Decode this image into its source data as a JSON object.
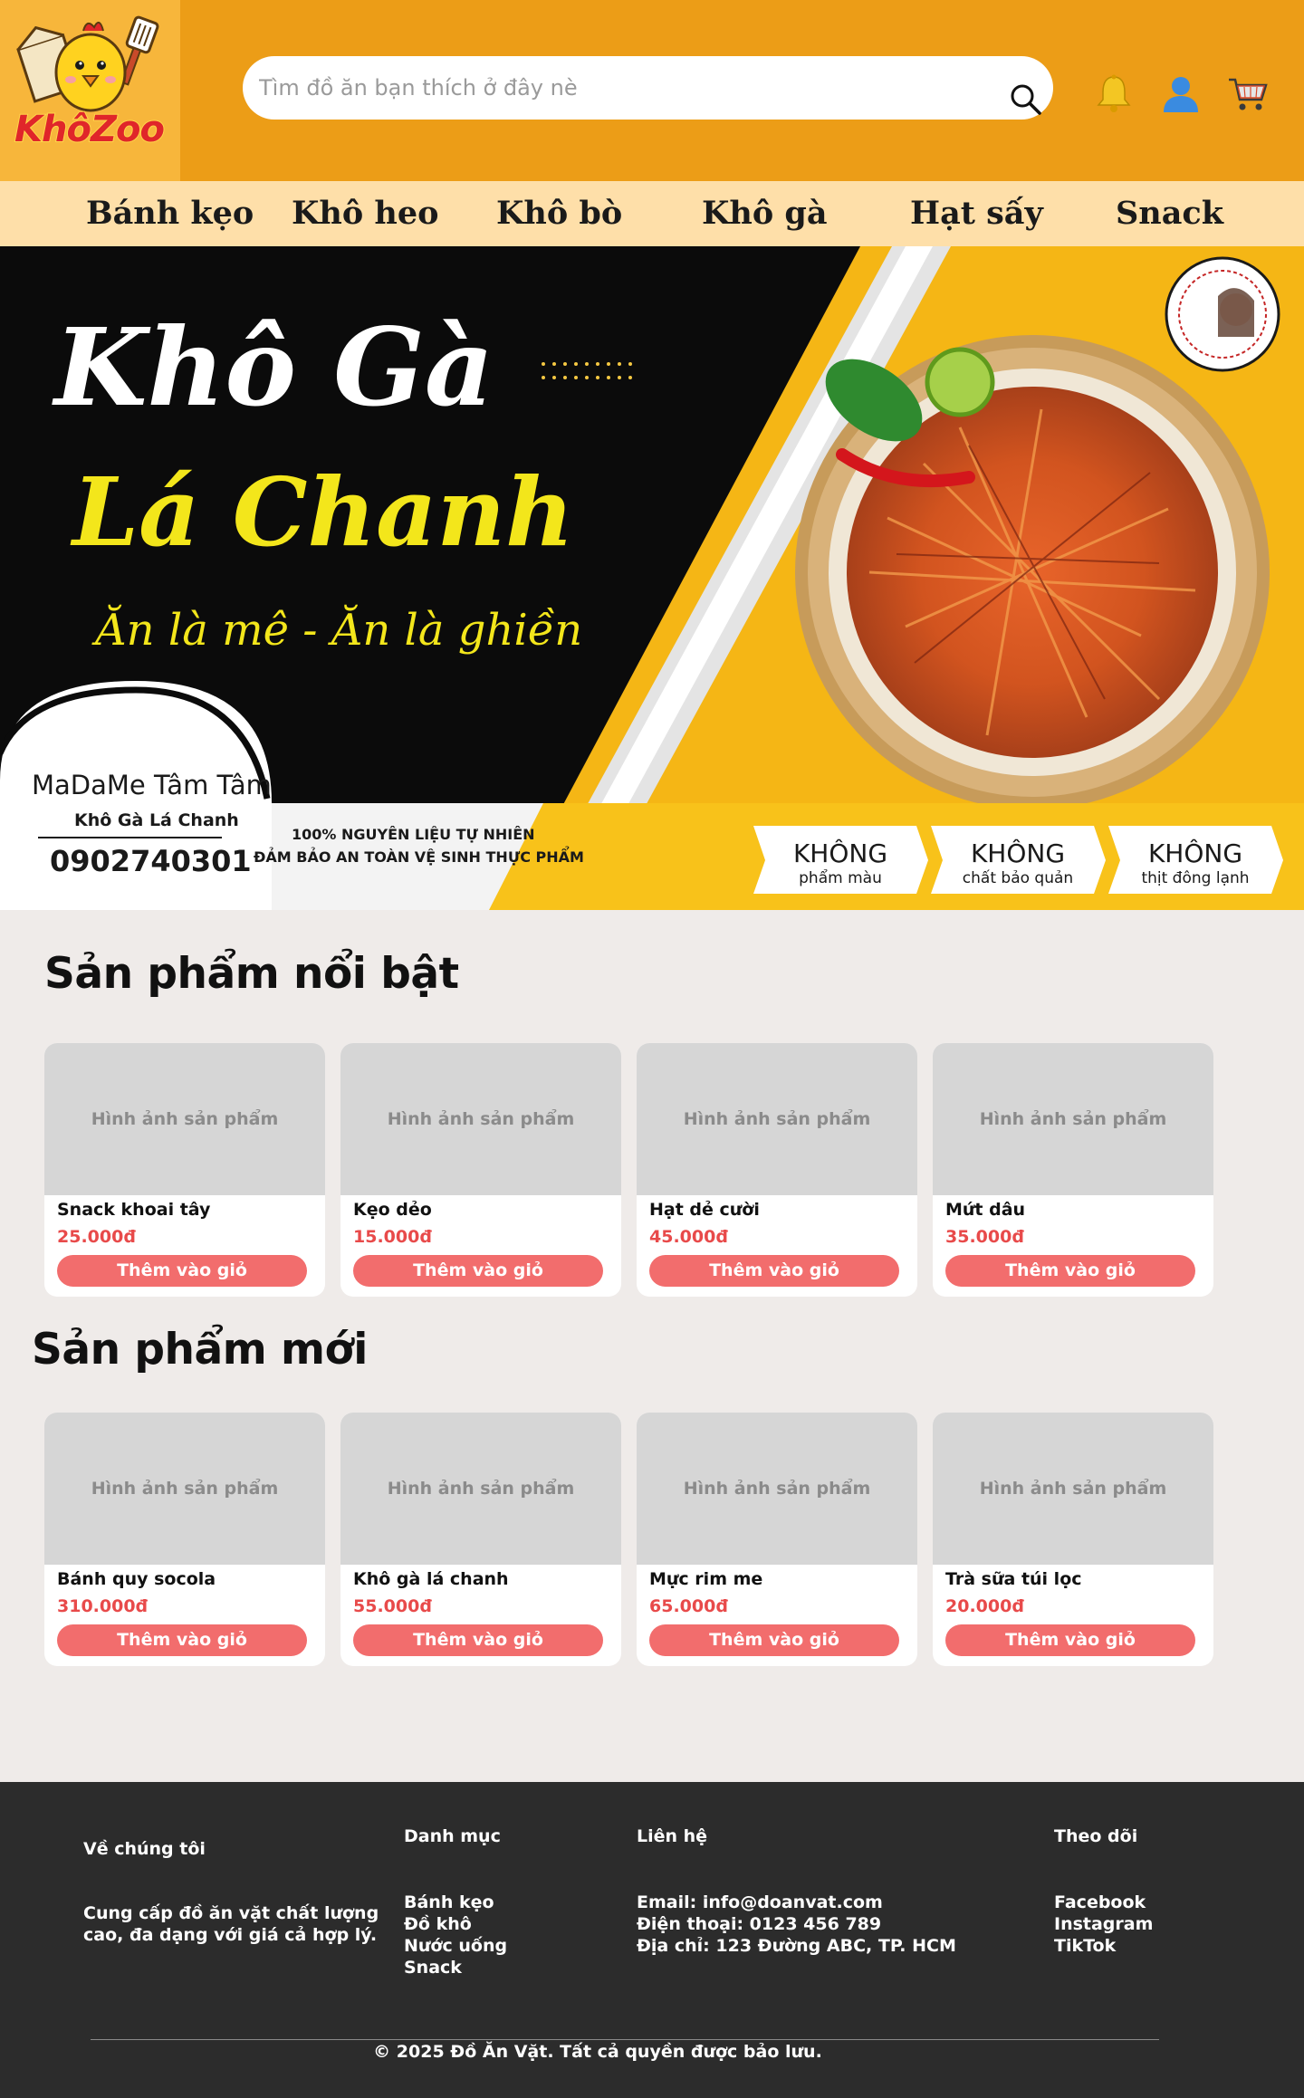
{
  "brand": {
    "name": "KhôZoo"
  },
  "search": {
    "placeholder": "Tìm đồ ăn bạn thích ở đây nè"
  },
  "header_icons": [
    "bell-icon",
    "user-icon",
    "cart-icon"
  ],
  "nav": {
    "items": [
      {
        "label": "Bánh kẹo"
      },
      {
        "label": "Khô heo"
      },
      {
        "label": "Khô bò"
      },
      {
        "label": "Khô gà"
      },
      {
        "label": "Hạt sấy"
      },
      {
        "label": "Snack"
      }
    ]
  },
  "banner": {
    "title_line1": "Khô Gà",
    "title_line2": "Lá Chanh",
    "slogan": "Ăn là mê - Ăn là ghiền",
    "shop_name": "MaDaMe Tâm Tâm",
    "product": "Khô Gà Lá Chanh",
    "phone": "0902740301",
    "claim1": "100% NGUYÊN LIỆU TỰ NHIÊN",
    "claim2": "ĐẢM BẢO AN TOÀN VỆ SINH THỰC PHẨM",
    "badges": [
      {
        "title": "KHÔNG",
        "sub": "phẩm màu"
      },
      {
        "title": "KHÔNG",
        "sub": "chất bảo quản"
      },
      {
        "title": "KHÔNG",
        "sub": "thịt đông lạnh"
      }
    ]
  },
  "featured": {
    "title": "Sản phẩm nổi bật",
    "products": [
      {
        "image_label": "Hình ảnh sản phẩm",
        "name": "Snack khoai tây",
        "price": "25.000đ",
        "button": "Thêm vào giỏ"
      },
      {
        "image_label": "Hình ảnh sản phẩm",
        "name": "Kẹo dẻo",
        "price": "15.000đ",
        "button": "Thêm vào giỏ"
      },
      {
        "image_label": "Hình ảnh sản phẩm",
        "name": "Hạt dẻ cười",
        "price": "45.000đ",
        "button": "Thêm vào giỏ"
      },
      {
        "image_label": "Hình ảnh sản phẩm",
        "name": "Mứt dâu",
        "price": "35.000đ",
        "button": "Thêm vào giỏ"
      }
    ]
  },
  "new_products": {
    "title": "Sản phẩm mới",
    "products": [
      {
        "image_label": "Hình ảnh sản phẩm",
        "name": "Bánh quy socola",
        "price": "310.000đ",
        "button": "Thêm vào giỏ"
      },
      {
        "image_label": "Hình ảnh sản phẩm",
        "name": "Khô gà lá chanh",
        "price": "55.000đ",
        "button": "Thêm vào giỏ"
      },
      {
        "image_label": "Hình ảnh sản phẩm",
        "name": "Mực rim me",
        "price": "65.000đ",
        "button": "Thêm vào giỏ"
      },
      {
        "image_label": "Hình ảnh sản phẩm",
        "name": "Trà sữa túi lọc",
        "price": "20.000đ",
        "button": "Thêm vào giỏ"
      }
    ]
  },
  "footer": {
    "about": {
      "title": "Về chúng tôi",
      "text_line1": "Cung cấp đồ ăn vặt chất lượng",
      "text_line2": "cao, đa dạng với giá cả hợp lý."
    },
    "categories": {
      "title": "Danh mục",
      "items": [
        "Bánh kẹo",
        "Đồ khô",
        "Nước uống",
        "Snack"
      ]
    },
    "contact": {
      "title": "Liên hệ",
      "email": "Email: info@doanvat.com",
      "phone": "Điện thoại: 0123 456 789",
      "address": "Địa chỉ: 123 Đường ABC, TP. HCM"
    },
    "follow": {
      "title": "Theo dõi",
      "items": [
        "Facebook",
        "Instagram",
        "TikTok"
      ]
    },
    "copyright": "© 2025 Đồ Ăn Vặt. Tất cả quyền được bảo lưu."
  },
  "colors": {
    "header_bg": "#ec9d17",
    "logo_bg": "#f7b63b",
    "nav_bg": "#fedfa9",
    "page_bg": "#efebe9",
    "price": "#e84a4a",
    "button": "#f26d6d",
    "footer_bg": "#2c2c2c"
  }
}
